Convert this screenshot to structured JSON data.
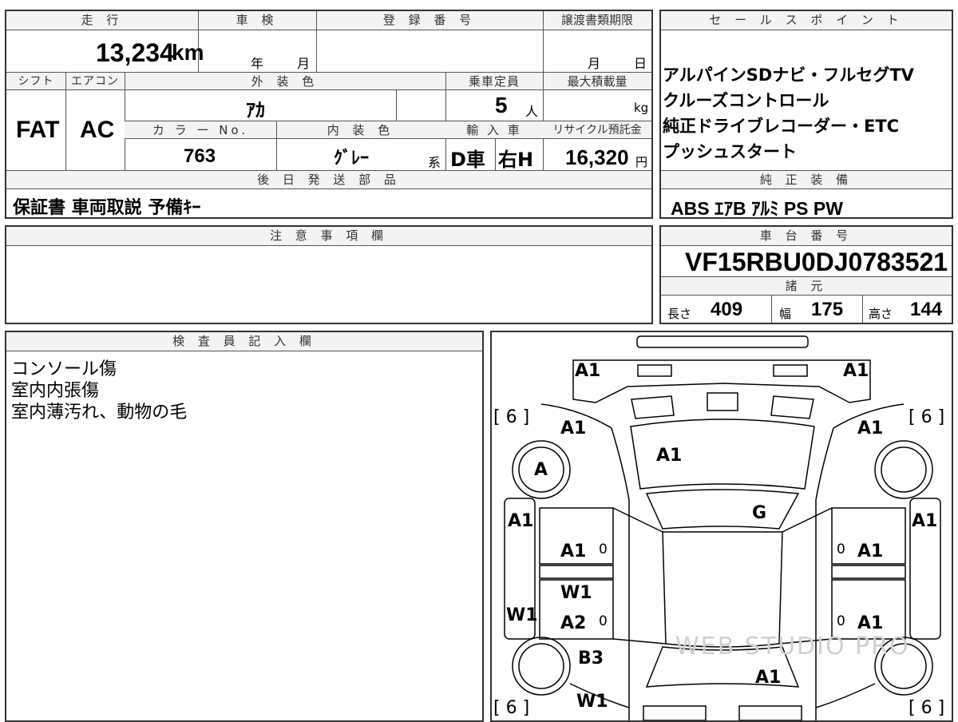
{
  "top": {
    "mileage_label": "走 行",
    "mileage_value": "13,234",
    "mileage_unit": "km",
    "inspection_label": "車 検",
    "inspection_year_unit": "年",
    "inspection_month_unit": "月",
    "registration_label": "登 録 番 号",
    "transfer_label": "譲渡書類期限",
    "transfer_month_unit": "月",
    "transfer_day_unit": "日"
  },
  "specs": {
    "shift_label": "シフト",
    "shift_value": "FAT",
    "ac_label": "エアコン",
    "ac_value": "AC",
    "exterior_label": "外 装 色",
    "exterior_value": "ｱｶ",
    "capacity_label": "乗車定員",
    "capacity_value": "5",
    "capacity_unit": "人",
    "maxload_label": "最大積載量",
    "maxload_unit": "kg",
    "colorno_label": "カ ラ ー No.",
    "colorno_value": "763",
    "interior_label": "内 装 色",
    "interior_value": "ｸﾞﾚｰ",
    "interior_suffix": "系",
    "import_label": "輸 入 車",
    "import_type": "D車",
    "import_steering": "右H",
    "recycle_label": "リサイクル預託金",
    "recycle_value": "16,320",
    "recycle_unit": "円"
  },
  "later_parts": {
    "label": "後 日 発 送 部 品",
    "value": "保証書 車両取説 予備ｷｰ"
  },
  "sales_points": {
    "label": "セ ー ル ス ポ イ ン ト",
    "lines": [
      "アルパインSDナビ・フルセグTV",
      "クルーズコントロール",
      "純正ドライブレコーダー・ETC",
      "プッシュスタート"
    ]
  },
  "equipment": {
    "label": "純 正 装 備",
    "value": "ABS ｴｱB ｱﾙﾐ PS PW"
  },
  "notes": {
    "label": "注 意 事 項 欄"
  },
  "chassis": {
    "label": "車 台 番 号",
    "value": "VF15RBU0DJ0783521",
    "dims_label": "諸 元",
    "length_label": "長さ",
    "length_value": "409",
    "width_label": "幅",
    "width_value": "175",
    "height_label": "高さ",
    "height_value": "144"
  },
  "inspector": {
    "label": "検 査 員 記 入 欄",
    "lines": [
      "コンソール傷",
      "室内内張傷",
      "室内薄汚れ、動物の毛"
    ]
  },
  "diagram": {
    "watermark": "WEB STUDIO PRO",
    "marks": {
      "front_left_bumper": "A1",
      "front_right_bumper": "A1",
      "hood_left": "A1",
      "hood_center": "A1",
      "hood_right": "A1",
      "front_wheel_left": "A",
      "windshield": "G",
      "left_fender": "A1",
      "right_fender": "A1",
      "front_door_left": "A1",
      "front_door_right": "A1",
      "rear_door_left_upper": "W1",
      "rocker_left": "W1",
      "rear_door_left": "A2",
      "rear_door_right": "A1",
      "rear_fender_left": "B3",
      "roof_rear": "A1",
      "rear_quarter_left": "W1"
    },
    "zeros": [
      "0",
      "0",
      "0",
      "0"
    ],
    "tread_left_top": "6",
    "tread_right_top": "6",
    "tread_left_bottom": "6",
    "tread_right_bottom": "6"
  }
}
